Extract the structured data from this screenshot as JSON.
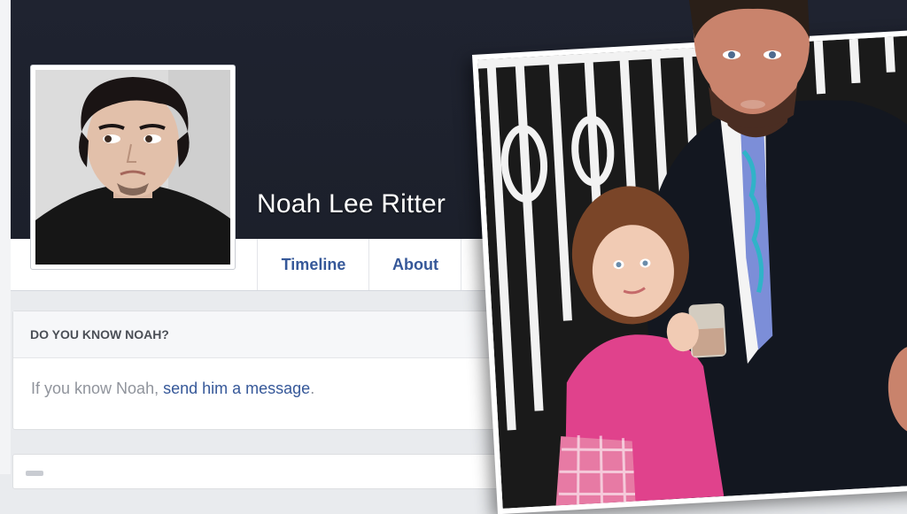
{
  "profile": {
    "name": "Noah Lee Ritter"
  },
  "nav": {
    "tabs": [
      {
        "label": "Timeline"
      },
      {
        "label": "About"
      }
    ]
  },
  "know_card": {
    "header": "DO YOU KNOW NOAH?",
    "body_prefix": "If you know Noah, ",
    "link_text": "send him a message",
    "body_suffix": "."
  },
  "colors": {
    "cover": "#1f2330",
    "link": "#365899",
    "page_bg": "#e9ebee"
  }
}
